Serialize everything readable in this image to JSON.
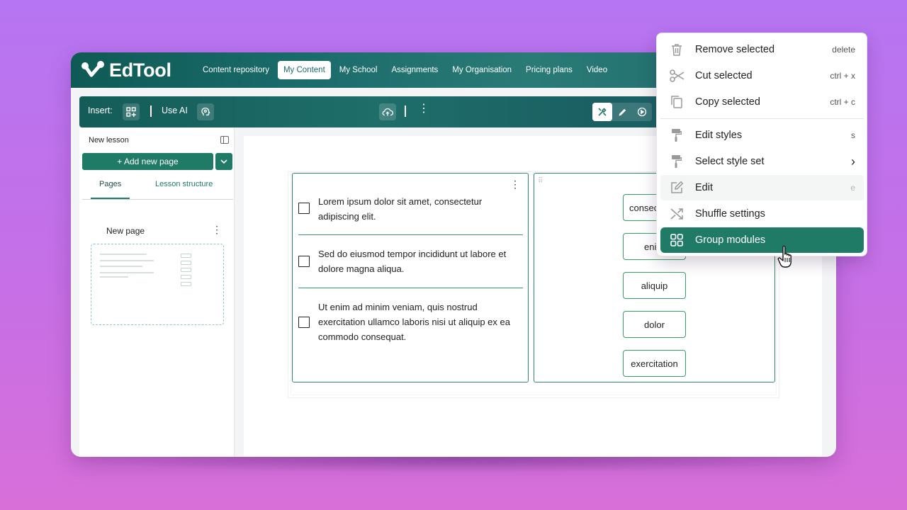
{
  "app": {
    "logo_text": "EdTool",
    "colors": {
      "primary": "#1f7a66",
      "nav_bg": "#1a6b6a",
      "background": "#c270ea"
    }
  },
  "nav": {
    "links": [
      {
        "label": "Content repository",
        "active": false
      },
      {
        "label": "My Content",
        "active": true
      },
      {
        "label": "My School",
        "active": false
      },
      {
        "label": "Assignments",
        "active": false
      },
      {
        "label": "My Organisation",
        "active": false
      },
      {
        "label": "Pricing plans",
        "active": false
      },
      {
        "label": "Video",
        "active": false
      }
    ]
  },
  "toolbar": {
    "insert_label": "Insert:",
    "use_ai_label": "Use AI",
    "icons": [
      "grid-add-icon",
      "ai-brain-icon",
      "cloud-upload-icon",
      "more-vertical-icon",
      "tools-icon",
      "pencil-icon",
      "play-icon"
    ]
  },
  "sidebar": {
    "lesson_title": "New lesson",
    "add_page_label": "+ Add new page",
    "tabs": [
      {
        "label": "Pages",
        "active": true
      },
      {
        "label": "Lesson structure",
        "active": false
      }
    ],
    "pages": [
      {
        "name": "New page"
      }
    ]
  },
  "quiz": {
    "items": [
      {
        "text": "Lorem ipsum dolor sit amet, consectetur adipiscing elit.",
        "checked": false
      },
      {
        "text": "Sed do eiusmod tempor incididunt ut labore et dolore magna aliqua.",
        "checked": false
      },
      {
        "text": "Ut enim ad minim veniam, quis nostrud exercitation ullamco laboris nisi ut aliquip ex ea commodo consequat.",
        "checked": false
      }
    ]
  },
  "drag_words": {
    "words": [
      "consec",
      "eni",
      "aliquip",
      "dolor",
      "exercitation"
    ]
  },
  "context_menu": {
    "items": [
      {
        "label": "Remove selected",
        "shortcut": "delete",
        "icon": "trash-icon"
      },
      {
        "label": "Cut selected",
        "shortcut": "ctrl + x",
        "icon": "scissors-icon"
      },
      {
        "label": "Copy selected",
        "shortcut": "ctrl + c",
        "icon": "copy-icon"
      },
      {
        "label": "Edit styles",
        "shortcut": "s",
        "icon": "paint-roller-icon"
      },
      {
        "label": "Select style set",
        "shortcut": "›",
        "icon": "paint-roller-icon"
      },
      {
        "label": "Edit",
        "shortcut": "e",
        "icon": "edit-icon"
      },
      {
        "label": "Shuffle settings",
        "shortcut": "",
        "icon": "shuffle-icon"
      },
      {
        "label": "Group modules",
        "shortcut": "",
        "icon": "group-modules-icon"
      }
    ]
  }
}
